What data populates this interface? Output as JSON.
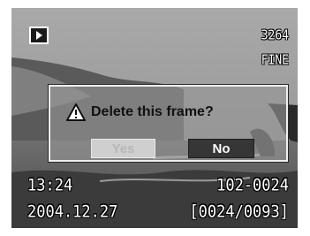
{
  "icons": {
    "play_mode": "playback-icon",
    "warning": "warning-icon"
  },
  "status": {
    "image_size": "3264",
    "quality": "FINE",
    "time": "13:24",
    "date": "2004.12.27",
    "folder_file": "102-0024",
    "frame_counter": "[0024/0093]"
  },
  "dialog": {
    "message": "Delete this frame?",
    "yes_label": "Yes",
    "no_label": "No",
    "selected": "No"
  }
}
